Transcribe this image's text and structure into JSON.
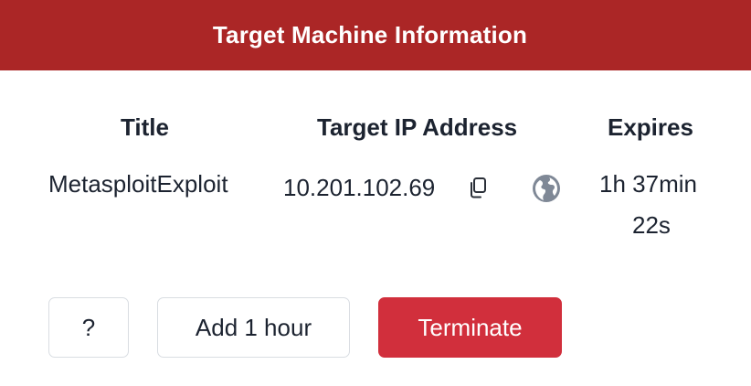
{
  "header": {
    "title": "Target Machine Information",
    "color": "#ab2626"
  },
  "table": {
    "columns": [
      "Title",
      "Target IP Address",
      "Expires"
    ],
    "row": {
      "title": "MetasploitExploit",
      "ip": "10.201.102.69",
      "expires_line1": "1h 37min",
      "expires_line2": "22s"
    },
    "icons": [
      "copy-icon",
      "globe-icon"
    ]
  },
  "buttons": {
    "help": "?",
    "add_hour": "Add 1 hour",
    "terminate": "Terminate",
    "terminate_color": "#d12f3c"
  }
}
